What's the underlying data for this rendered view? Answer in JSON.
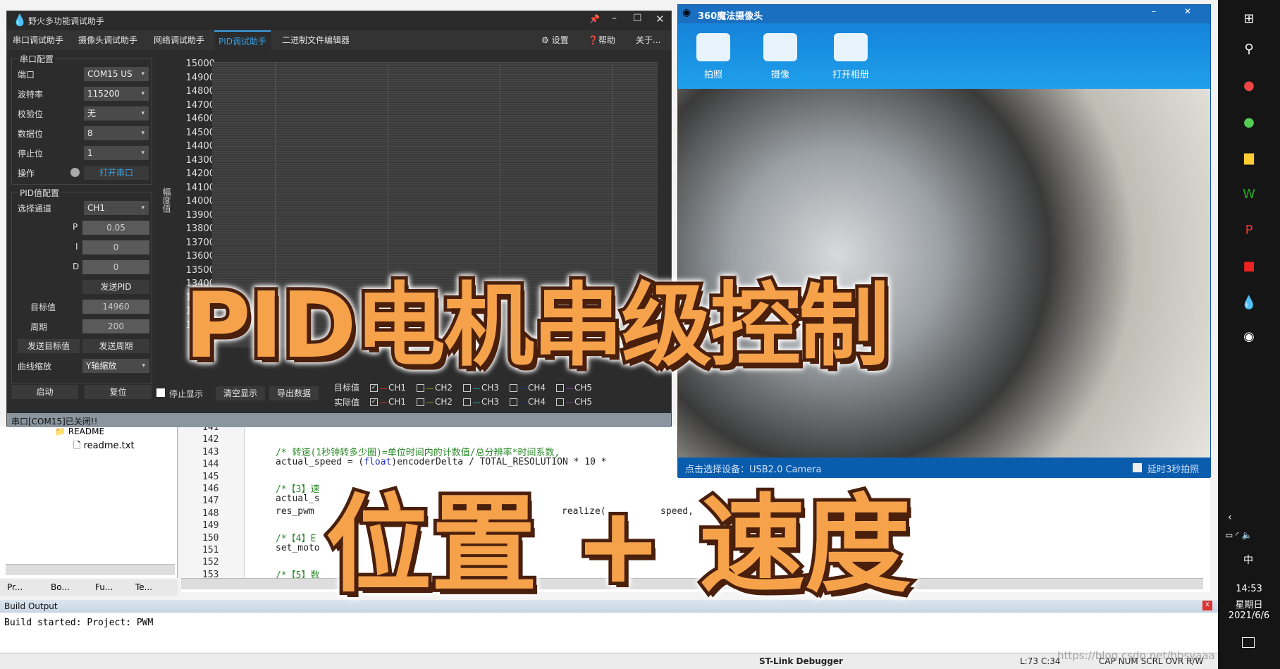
{
  "pid_app": {
    "title": "野火多功能调试助手",
    "tabs": [
      "串口调试助手",
      "摄像头调试助手",
      "网络调试助手",
      "PID调试助手",
      "二进制文件编辑器"
    ],
    "right_tabs": [
      "设置",
      "帮助",
      "关于..."
    ],
    "serial": {
      "group": "串口配置",
      "port_label": "端口",
      "port": "COM15 US",
      "baud_label": "波特率",
      "baud": "115200",
      "parity_label": "校验位",
      "parity": "无",
      "data_label": "数据位",
      "data": "8",
      "stop_label": "停止位",
      "stop": "1",
      "op_label": "操作",
      "open_button": "打开串口"
    },
    "pid": {
      "group": "PID值配置",
      "channel_label": "选择通道",
      "channel": "CH1",
      "p_label": "P",
      "p": "0.05",
      "i_label": "I",
      "i": "0",
      "d_label": "D",
      "d": "0",
      "send_pid": "发送PID",
      "target_label": "目标值",
      "target": "14960",
      "period_label": "周期",
      "period": "200",
      "send_target": "发送目标值",
      "send_period": "发送周期",
      "zoom_label": "曲线缩放",
      "zoom": "Y轴缩放"
    },
    "chart": {
      "ylabel": "幅度值",
      "yticks": [
        "15000",
        "14900",
        "14800",
        "14700",
        "14600",
        "14500",
        "14400",
        "14300",
        "14200",
        "14100",
        "14000",
        "13900",
        "13800",
        "13700",
        "13600",
        "13500",
        "13400",
        "13300",
        "13200",
        "13100"
      ]
    },
    "bottom": {
      "start": "启动",
      "reset": "复位",
      "stop_display": "停止显示",
      "clear": "清空显示",
      "export": "导出数据",
      "target_row": "目标值",
      "actual_row": "实际值",
      "channels": [
        "CH1",
        "CH2",
        "CH3",
        "CH4",
        "CH5"
      ],
      "channel_colors": [
        "#d03030",
        "#8a8a20",
        "#20a0a0",
        "#203080",
        "#8040a0"
      ],
      "target_checked": [
        true,
        false,
        false,
        false,
        false
      ],
      "actual_checked": [
        true,
        false,
        false,
        false,
        false
      ]
    },
    "status": "串口[COM15]已关闭!!"
  },
  "camera": {
    "title": "360魔法摄像头",
    "buttons": [
      "拍照",
      "摄像",
      "打开相册"
    ],
    "device": "点击选择设备：USB2.0 Camera",
    "delay": "延时3秒拍照"
  },
  "ide": {
    "tree": [
      "README",
      "readme.txt"
    ],
    "panel_tabs": [
      "Pr...",
      "Bo...",
      "Fu...",
      "Te..."
    ],
    "lines": [
      "141",
      "142",
      "143",
      "144",
      "145",
      "146",
      "147",
      "148",
      "149",
      "150",
      "151",
      "152",
      "153"
    ],
    "code": {
      "143": "/* 转速(1秒钟转多少圈)=单位时间内的计数值/总分辨率*时间系数,",
      "144a": "actual_speed = (",
      "144kw": "float",
      "144b": ")encoderDelta / TOTAL_RESOLUTION * 10 *",
      "146": "/*【3】速",
      "147": "actual_s",
      "148a": "res_pwm",
      "148b": "realize(",
      "148c": "speed,",
      "150": "/*【4】E",
      "151": "set_moto",
      "153": "/*【5】数"
    },
    "build_header": "Build Output",
    "build_text": "Build started: Project: PWM",
    "status": {
      "debugger": "ST-Link Debugger",
      "pos": "L:73 C:34",
      "flags": "CAP NUM SCRL OVR R/W",
      "watermark": "https://blog.csdn.net/hbsyaaa"
    }
  },
  "taskbar": {
    "time": "14:53",
    "weekday": "星期日",
    "date": "2021/6/6",
    "ime": "中"
  },
  "overlay": {
    "title": "PID电机串级控制",
    "subtitle": "位置 + 速度"
  }
}
